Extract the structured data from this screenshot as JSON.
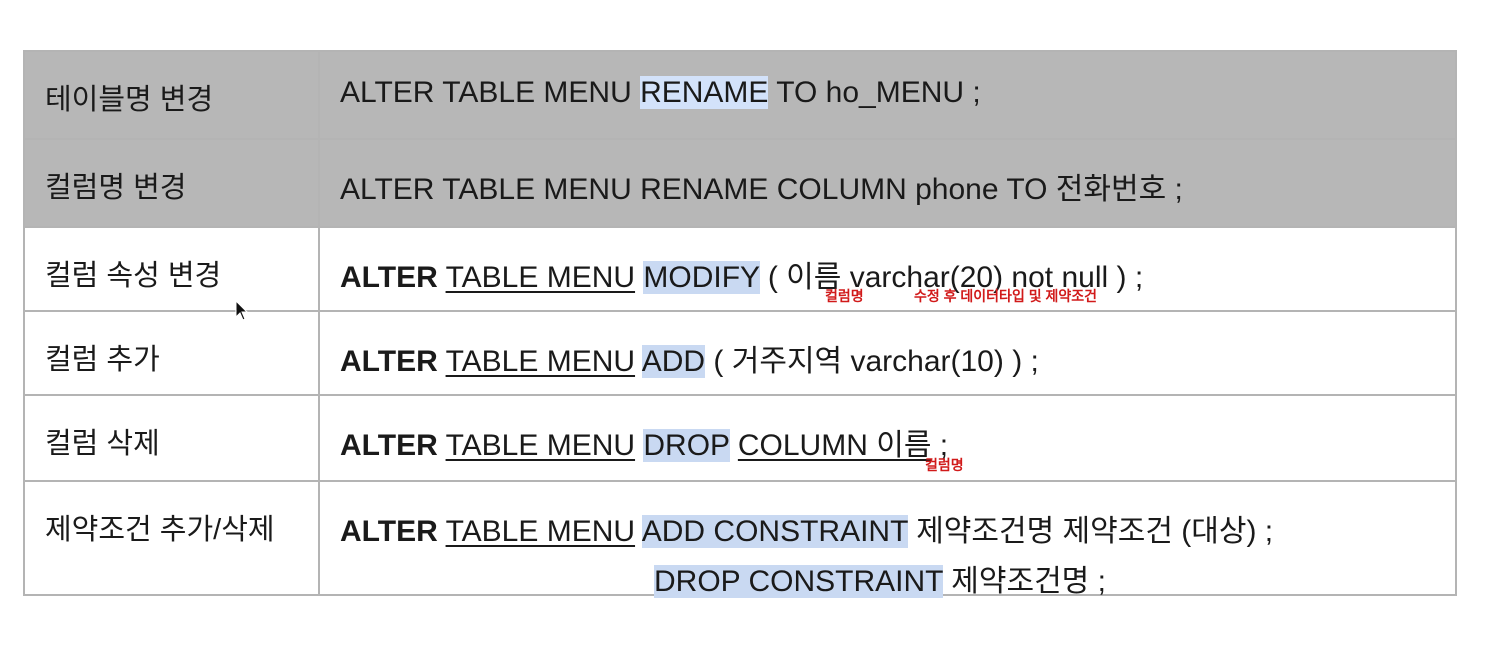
{
  "rows": [
    {
      "label": "테이블명 변경",
      "shaded": true,
      "code": {
        "a": "ALTER TABLE MENU ",
        "kw": "RENAME",
        "b": " TO ho_MENU ;"
      }
    },
    {
      "label": "컬럼명 변경",
      "shaded": true,
      "code": {
        "text": "ALTER TABLE MENU RENAME COLUMN phone TO 전화번호 ;"
      }
    },
    {
      "label": "컬럼 속성 변경",
      "code": {
        "alter": "ALTER",
        "table": "TABLE MENU",
        "kw": "MODIFY",
        "rest": " ( 이름 varchar(20) not null ) ;"
      },
      "notes": {
        "n1": "컬럼명",
        "n2": "수정 후 데이터타입 및 제약조건"
      }
    },
    {
      "label": "컬럼 추가",
      "code": {
        "alter": "ALTER",
        "table": "TABLE MENU",
        "kw": "ADD",
        "rest": " ( 거주지역 varchar(10) ) ;"
      }
    },
    {
      "label": "컬럼 삭제",
      "code": {
        "alter": "ALTER",
        "table": "TABLE MENU",
        "kw": "DROP",
        "col": "COLUMN 이름",
        "rest": " ;"
      },
      "notes": {
        "n1": "컬럼명"
      }
    },
    {
      "label": "제약조건 추가/삭제",
      "code": {
        "alter": "ALTER",
        "table": "TABLE MENU",
        "kw": "ADD CONSTRAINT",
        "rest": " 제약조건명 제약조건 (대상) ;",
        "kw2": "DROP CONSTRAINT",
        "rest2": " 제약조건명 ;"
      }
    }
  ]
}
